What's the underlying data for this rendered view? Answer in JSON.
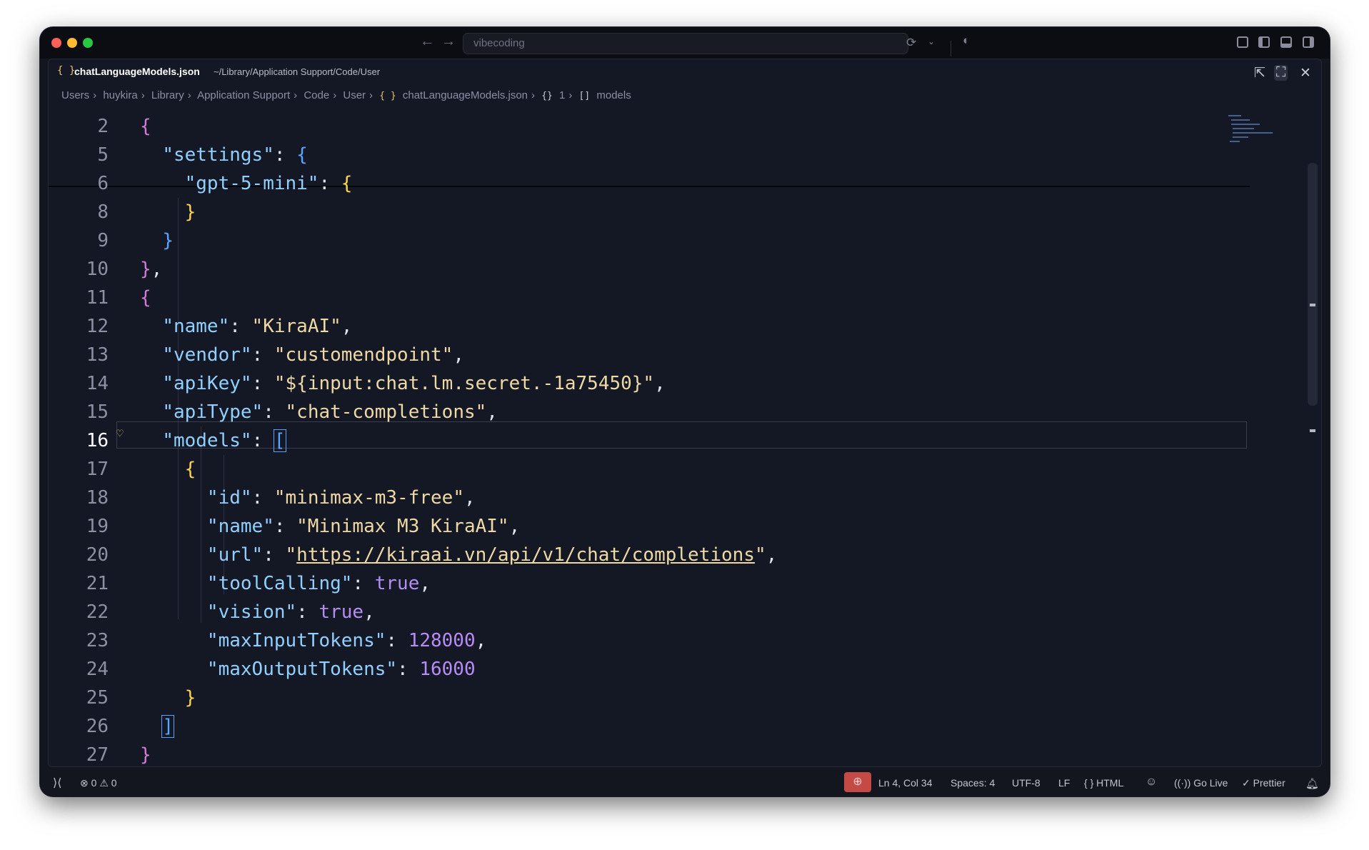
{
  "window": {
    "command_center_text": "vibecoding"
  },
  "tab": {
    "file_name": "chatLanguageModels.json",
    "file_path": "~/Library/Application Support/Code/User",
    "curly_icon_text": "{ }"
  },
  "breadcrumb": [
    "Users",
    "huykira",
    "Library",
    "Application Support",
    "Code",
    "User"
  ],
  "breadcrumb_file": "chatLanguageModels.json",
  "breadcrumb_symbol_index": "1",
  "breadcrumb_symbol_models": "models",
  "code_lines": [
    {
      "num": "2"
    },
    {
      "num": "5"
    },
    {
      "num": "6"
    },
    {
      "num": "8"
    },
    {
      "num": "9"
    },
    {
      "num": "10"
    },
    {
      "num": "11"
    },
    {
      "num": "12"
    },
    {
      "num": "13"
    },
    {
      "num": "14"
    },
    {
      "num": "15"
    },
    {
      "num": "16"
    },
    {
      "num": "17"
    },
    {
      "num": "18"
    },
    {
      "num": "19"
    },
    {
      "num": "20"
    },
    {
      "num": "21"
    },
    {
      "num": "22"
    },
    {
      "num": "23"
    },
    {
      "num": "24"
    },
    {
      "num": "25"
    },
    {
      "num": "26"
    },
    {
      "num": "27"
    }
  ],
  "code": {
    "settings_key": "\"settings\"",
    "gpt_key": "\"gpt-5-mini\"",
    "name_key": "\"name\"",
    "name_val": "\"KiraAI\"",
    "vendor_key": "\"vendor\"",
    "vendor_val": "\"customendpoint\"",
    "apikey_key": "\"apiKey\"",
    "apikey_val": "\"${input:chat.lm.secret.-1a75450}\"",
    "apitype_key": "\"apiType\"",
    "apitype_val": "\"chat-completions\"",
    "models_key": "\"models\"",
    "id_key": "\"id\"",
    "id_val": "\"minimax-m3-free\"",
    "mname_key": "\"name\"",
    "mname_val": "\"Minimax M3 KiraAI\"",
    "url_key": "\"url\"",
    "url_val": "https://kiraai.vn/api/v1/chat/completions",
    "tool_key": "\"toolCalling\"",
    "tool_val": "true",
    "vision_key": "\"vision\"",
    "vision_val": "true",
    "maxin_key": "\"maxInputTokens\"",
    "maxin_val": "128000",
    "maxout_key": "\"maxOutputTokens\"",
    "maxout_val": "16000"
  },
  "status": {
    "errors": "0",
    "warnings": "0",
    "position": "Ln 4, Col 34",
    "spaces": "Spaces: 4",
    "encoding": "UTF-8",
    "eol": "LF",
    "language": "HTML",
    "go_live": "Go Live",
    "prettier": "Prettier"
  },
  "colors": {
    "background": "#13151f",
    "key": "#8fd0ff",
    "string": "#eed9a5",
    "number": "#b78cf5",
    "bracket_pink": "#d47bd9",
    "bracket_blue": "#58a6ff",
    "bracket_yellow": "#ffd54a"
  }
}
